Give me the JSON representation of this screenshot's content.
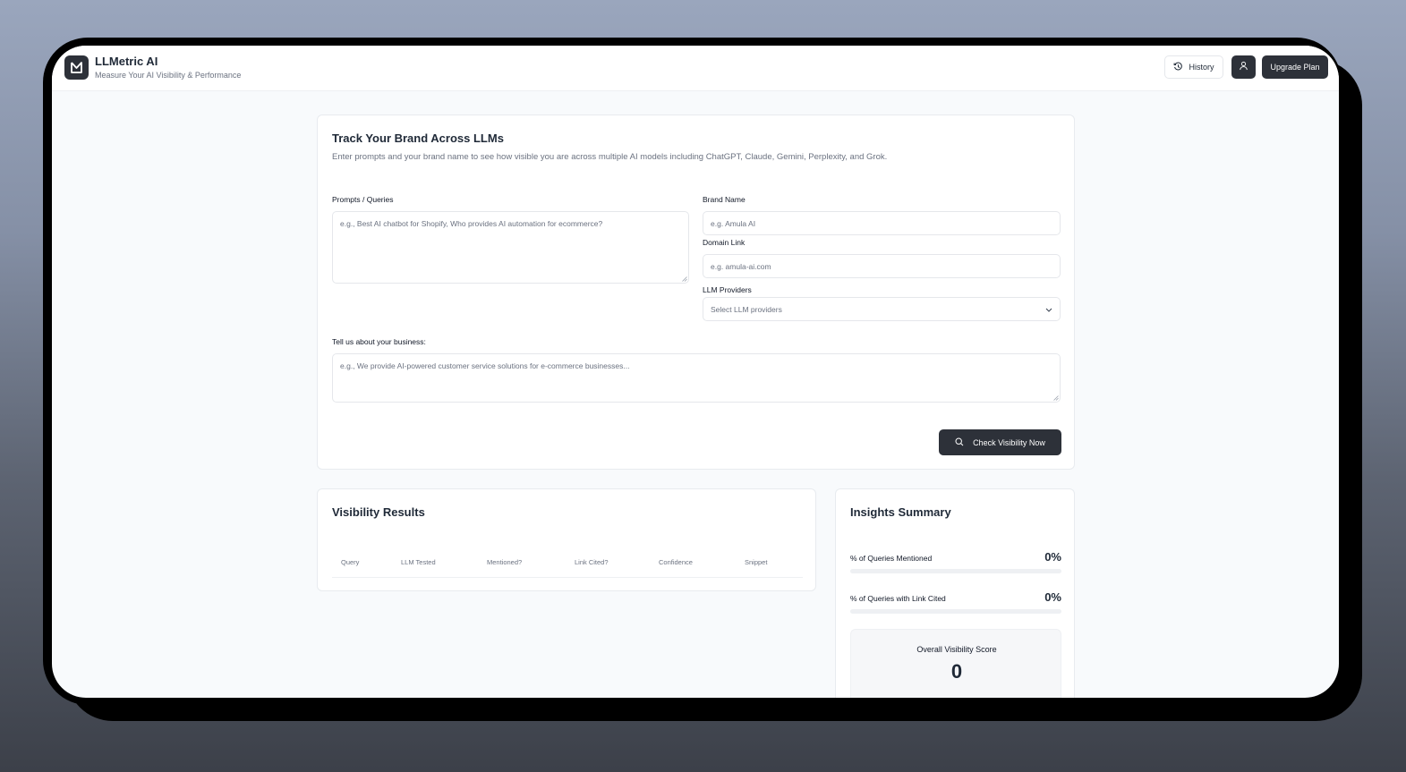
{
  "app": {
    "title": "LLMetric AI",
    "subtitle": "Measure Your AI Visibility & Performance",
    "logo_icon": "lm-logo-icon"
  },
  "header": {
    "history_label": "History",
    "history_icon": "history-icon",
    "user_icon": "user-icon",
    "upgrade_label": "Upgrade Plan"
  },
  "track": {
    "title": "Track Your Brand Across LLMs",
    "description": "Enter prompts and your brand name to see how visible you are across multiple AI models including ChatGPT, Claude, Gemini, Perplexity, and Grok.",
    "prompts_label": "Prompts / Queries",
    "prompts_placeholder": "e.g., Best AI chatbot for Shopify, Who provides AI automation for ecommerce?",
    "brand_label": "Brand Name",
    "brand_placeholder": "e.g. Amula AI",
    "domain_label": "Domain Link",
    "domain_placeholder": "e.g. amula-ai.com",
    "providers_label": "LLM Providers",
    "providers_placeholder": "Select LLM providers",
    "business_label": "Tell us about your business:",
    "business_placeholder": "e.g., We provide AI-powered customer service solutions for e-commerce businesses...",
    "check_label": "Check Visibility Now"
  },
  "results": {
    "title": "Visibility Results",
    "columns": [
      "Query",
      "LLM Tested",
      "Mentioned?",
      "Link Cited?",
      "Confidence",
      "Snippet"
    ]
  },
  "insights": {
    "title": "Insights Summary",
    "metrics": [
      {
        "label": "% of Queries Mentioned",
        "value": "0%",
        "fraction": 0
      },
      {
        "label": "% of Queries with Link Cited",
        "value": "0%",
        "fraction": 0
      }
    ],
    "score_label": "Overall Visibility Score",
    "score_value": "0"
  },
  "colors": {
    "primary": "#2d3139",
    "background": "#f8fafc",
    "border": "#e5e7eb"
  }
}
